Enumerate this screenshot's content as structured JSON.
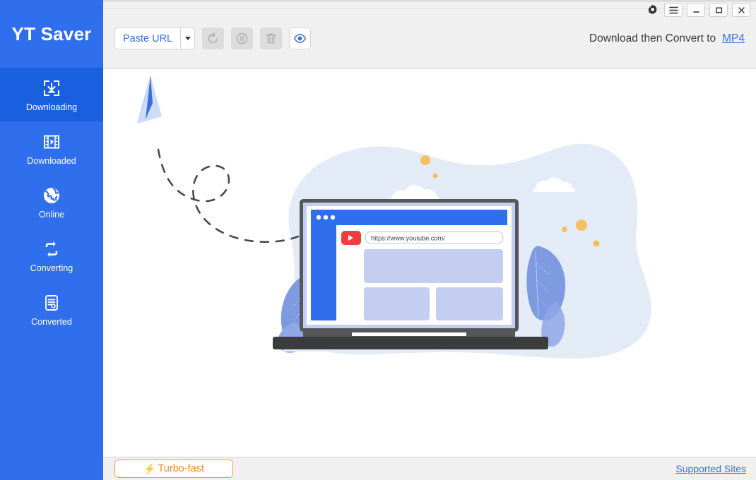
{
  "app": {
    "brand": "YT Saver",
    "accent_blue": "#2f6fee",
    "accent_blue_active": "#1a5fe0",
    "accent_orange": "#f08a1e",
    "link_blue": "#3b6fe0"
  },
  "sidebar": {
    "items": [
      {
        "label": "Downloading",
        "icon": "download-box-icon",
        "active": true
      },
      {
        "label": "Downloaded",
        "icon": "film-play-icon",
        "active": false
      },
      {
        "label": "Online",
        "icon": "globe-icon",
        "active": false
      },
      {
        "label": "Converting",
        "icon": "convert-loop-icon",
        "active": false
      },
      {
        "label": "Converted",
        "icon": "document-refresh-icon",
        "active": false
      }
    ]
  },
  "window_controls": {
    "settings": {
      "label": "Settings",
      "icon": "gear-icon"
    },
    "menu": {
      "label": "Menu",
      "icon": "hamburger-icon"
    },
    "minimize": {
      "label": "Minimize",
      "icon": "minimize-icon"
    },
    "maximize": {
      "label": "Maximize",
      "icon": "maximize-icon"
    },
    "close": {
      "label": "Close",
      "icon": "close-icon"
    }
  },
  "toolbar": {
    "paste_url_label": "Paste URL",
    "paste_url_caret": "chevron-down-icon",
    "buttons": [
      {
        "name": "restart",
        "icon": "restart-icon",
        "enabled": false
      },
      {
        "name": "pause",
        "icon": "pause-circle-icon",
        "enabled": false
      },
      {
        "name": "delete",
        "icon": "trash-icon",
        "enabled": false
      },
      {
        "name": "preview",
        "icon": "eye-icon",
        "enabled": true
      }
    ],
    "convert_text": "Download then Convert to",
    "convert_format": "MP4"
  },
  "illustration": {
    "browser_url": "https://www.youtube.com/",
    "play_icon": "youtube-play-icon",
    "plane_icon": "paper-plane-icon",
    "colors": {
      "blob": "#e3ebf7",
      "leaf": "#7e9ae0",
      "laptop_frame": "#555759",
      "laptop_base": "#3a3c3e",
      "browser_blue": "#2f6fee",
      "card": "#c3cef0",
      "card_light": "#ccd6f5",
      "dot_orange": "#f7c05e",
      "cloud": "#ffffff",
      "dash": "#4a4a4a",
      "youtube_red": "#f03c3c"
    }
  },
  "footer": {
    "turbo_label": "Turbo-fast",
    "turbo_icon": "lightning-bolt-icon",
    "supported_sites": "Supported Sites"
  }
}
